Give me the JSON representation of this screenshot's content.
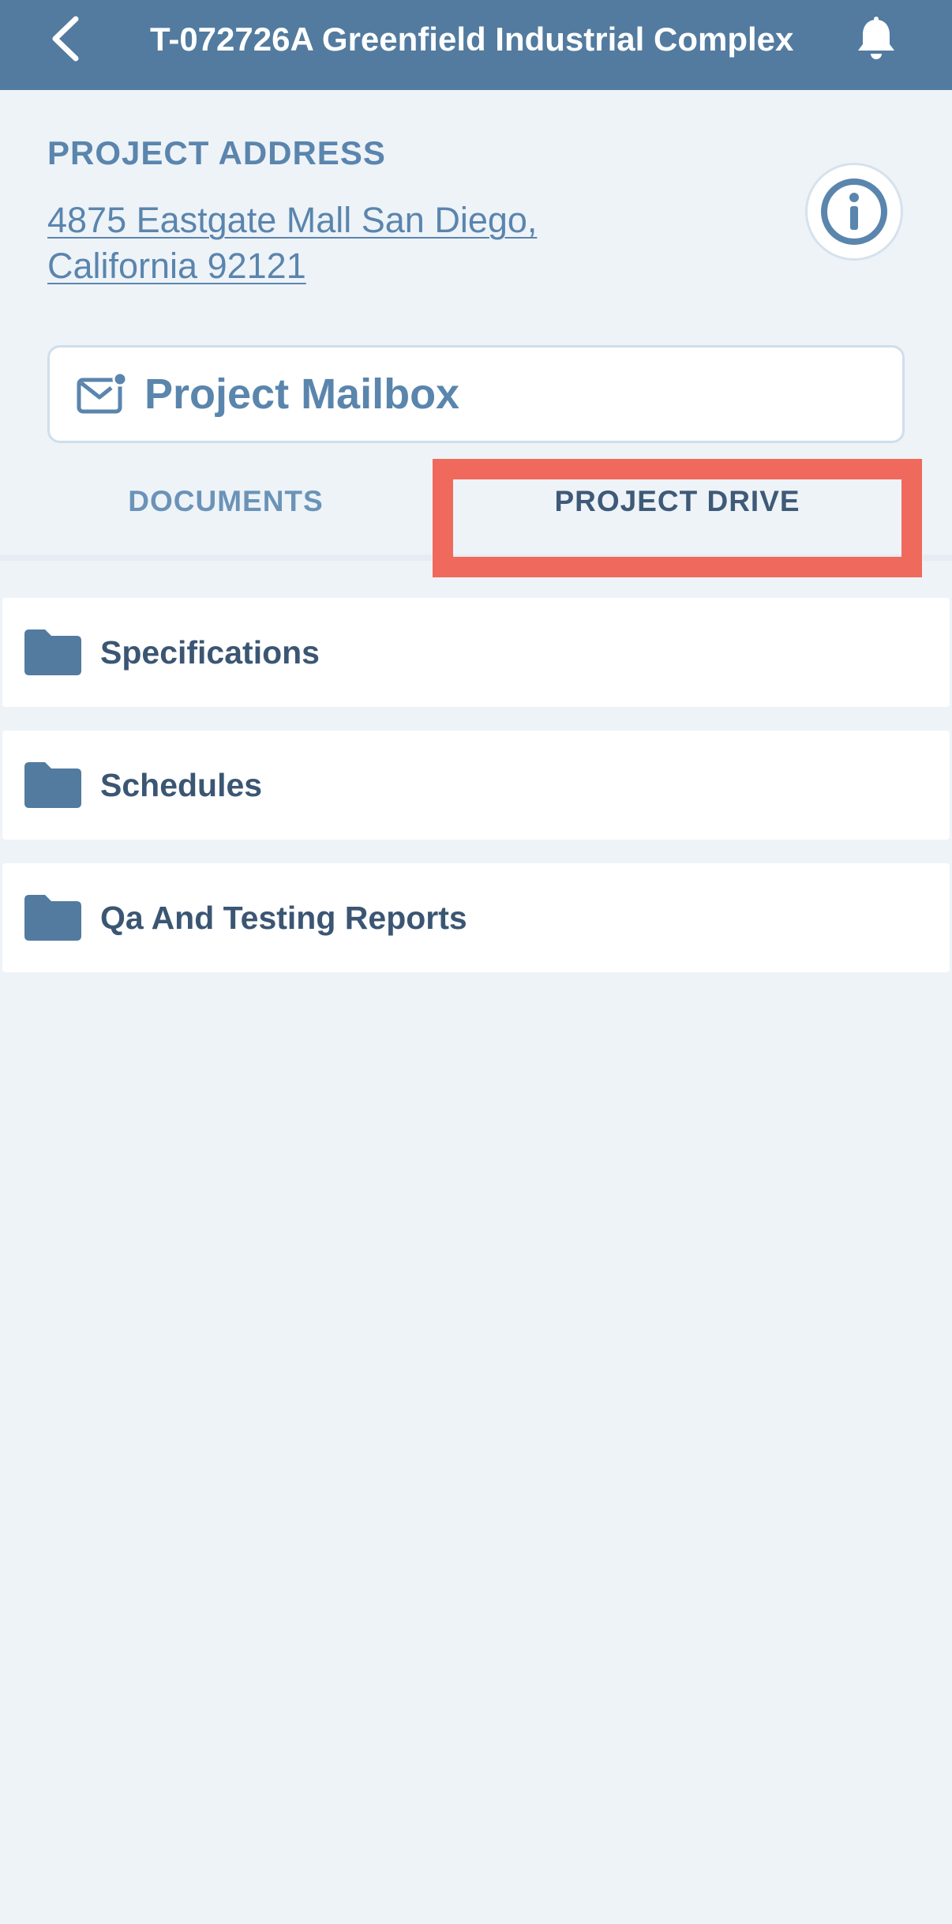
{
  "header": {
    "title": "T-072726A Greenfield Industrial Complex",
    "back_icon": "chevron-left-icon",
    "notification_icon": "bell-icon",
    "background_color": "#527b9f"
  },
  "project": {
    "address_label": "PROJECT ADDRESS",
    "address": "4875 Eastgate Mall  San Diego, California 92121",
    "info_icon": "info-icon"
  },
  "mailbox": {
    "label": "Project Mailbox",
    "icon": "mail-notification-icon"
  },
  "tabs": [
    {
      "label": "DOCUMENTS",
      "active": false
    },
    {
      "label": "PROJECT DRIVE",
      "active": true
    }
  ],
  "highlight_color": "#ef6a5c",
  "folders": [
    {
      "label": "Specifications",
      "icon": "folder-icon"
    },
    {
      "label": "Schedules",
      "icon": "folder-icon"
    },
    {
      "label": "Qa And Testing Reports",
      "icon": "folder-icon"
    }
  ]
}
